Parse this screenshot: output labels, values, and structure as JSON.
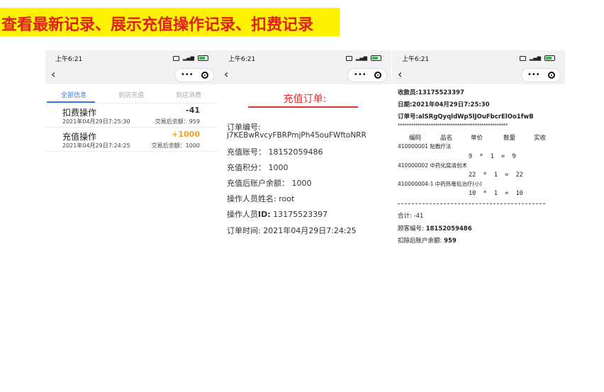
{
  "banner": {
    "title": "查看最新记录、展示充值操作记录、扣费记录"
  },
  "statusbar": {
    "time": "上午6:21",
    "network": "4G"
  },
  "phone1": {
    "tabs": [
      "全部信息",
      "到店充值",
      "到店消费"
    ],
    "records": [
      {
        "type": "扣费操作",
        "time": "2021年04月29日7:25:30",
        "amount": "-41",
        "balance": "交易后余额：959"
      },
      {
        "type": "充值操作",
        "time": "2021年04月29日7:24:25",
        "amount": "+1000",
        "balance": "交易后余额：1000"
      }
    ],
    "colors": {
      "accent": "#3b78e0",
      "positive": "#f0a020"
    }
  },
  "phone2": {
    "title": "充值订单:",
    "order_no_label": "订单编号:",
    "order_no": "j7KEBwRvcyFBRPmjPh45ouFWftoNRR",
    "account_label": "充值账号：",
    "account": "18152059486",
    "points_label": "充值积分：",
    "points": "1000",
    "balance_label": "充值后账户余额：",
    "balance": "1000",
    "operator_name_label": "操作人员姓名:",
    "operator_name": "root",
    "operator_id_label_a": "操作人员",
    "operator_id_label_b": "ID:",
    "operator_id": "13175523397",
    "order_time_label": "订单时间:",
    "order_time": "2021年04月29日7:24:25",
    "colors": {
      "title": "#e53030"
    }
  },
  "phone3": {
    "cashier": "收款员:13175523397",
    "date": "日期:2021年04月29日7:25:30",
    "order_no": "订单号:alSRgQyqldWp5lJOuFbcrElOo1fwB",
    "stars": "**************************************************",
    "headers": [
      "编码",
      "品名",
      "单价",
      "数量",
      "实收"
    ],
    "items": [
      {
        "line": "410000001 贴敷疗法",
        "calc": "9  *  1  =  9"
      },
      {
        "line": "410000002 中药化腐清创术",
        "calc": "22  *  1  =  22"
      },
      {
        "line": "410000004-1 中药热奄包治疗(小)",
        "calc": "10  *  1  =  10"
      }
    ],
    "total": "合计: -41",
    "customer_label": "顾客编号:",
    "customer": "18152059486",
    "remaining_label": "扣除后账户余额:",
    "remaining": "959"
  }
}
